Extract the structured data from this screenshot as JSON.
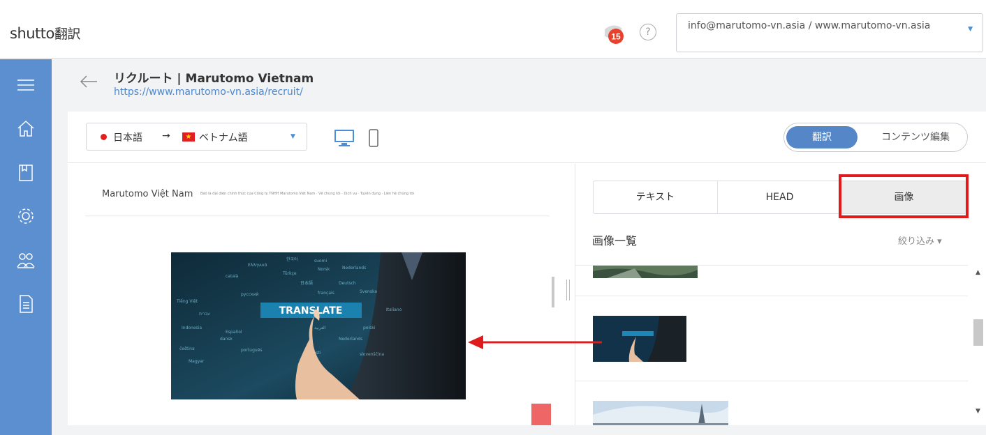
{
  "header": {
    "brand": "shutto",
    "brand_suffix": "翻訳",
    "notification_count": "15",
    "help_icon": "?",
    "account": "info@marutomo-vn.asia / www.marutomo-vn.asia"
  },
  "sidebar": {
    "items": [
      "menu-icon",
      "home-icon",
      "book-icon",
      "settings-icon",
      "users-icon",
      "document-icon"
    ]
  },
  "page": {
    "title": "リクルート | Marutomo Vietnam",
    "url": "https://www.marutomo-vn.asia/recruit/"
  },
  "toolbar": {
    "source_language": "日本語",
    "arrow": "→",
    "target_language": "ベトナム語",
    "mode_translate": "翻訳",
    "mode_content_edit": "コンテンツ編集"
  },
  "preview": {
    "site_name": "Marutomo Việt Nam",
    "site_nav": "Bảo là đại diện chính thức của Công ty TNHH Marutomo Việt Nam  ·  Về chúng tôi  ·  Dịch vụ  ·  Tuyển dụng  ·  Liên hệ chúng tôi",
    "hero_label": "TRANSLATE"
  },
  "panel": {
    "tabs": [
      "テキスト",
      "HEAD",
      "画像"
    ],
    "active_tab": "画像",
    "list_title": "画像一覧",
    "filter_label": "絞り込み ▾"
  },
  "colors": {
    "accent": "#5586c8",
    "rail": "#5b8fd0",
    "highlight": "#e01b1b",
    "badge": "#e8412c"
  }
}
